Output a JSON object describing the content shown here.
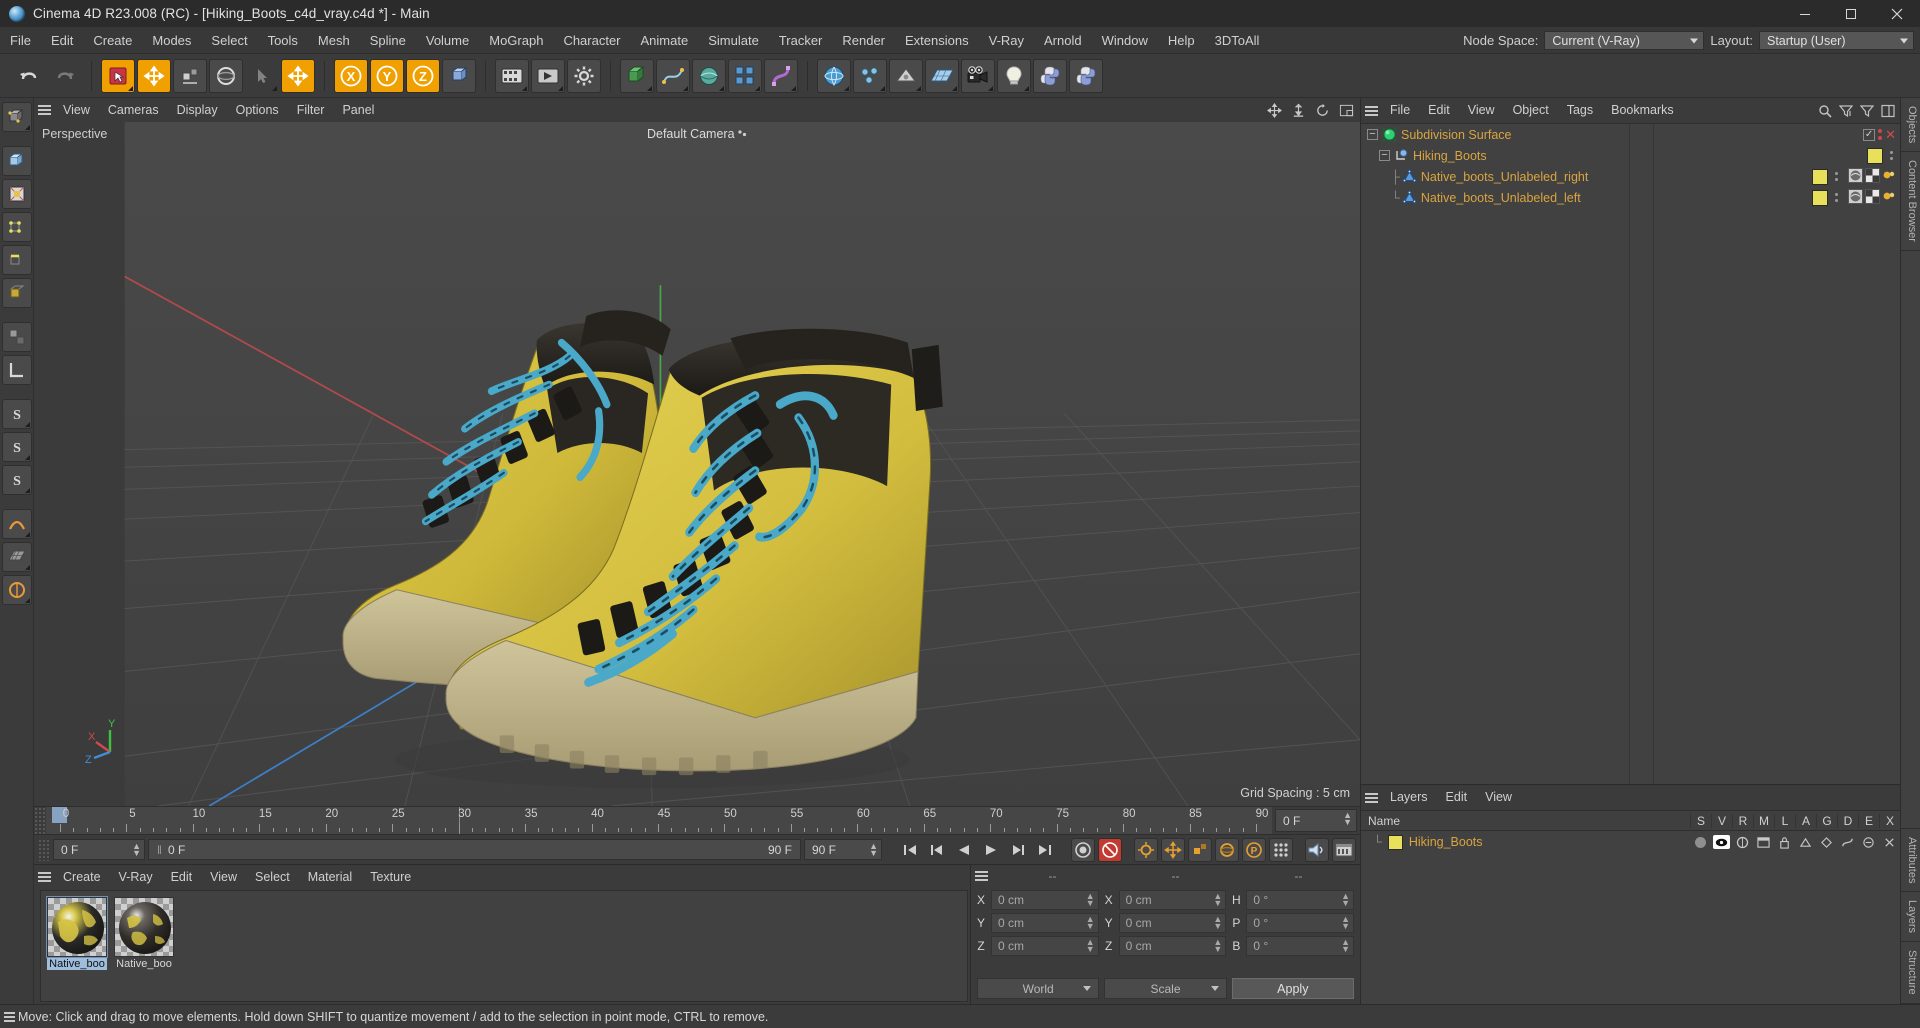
{
  "window": {
    "title": "Cinema 4D R23.008 (RC) - [Hiking_Boots_c4d_vray.c4d *] - Main",
    "logo": "cinema4d-logo-icon",
    "minimize": "minimize-icon",
    "maximize": "maximize-icon",
    "close": "close-icon"
  },
  "menubar": {
    "items": [
      "File",
      "Edit",
      "Create",
      "Modes",
      "Select",
      "Tools",
      "Mesh",
      "Spline",
      "Volume",
      "MoGraph",
      "Character",
      "Animate",
      "Simulate",
      "Tracker",
      "Render",
      "Extensions",
      "V-Ray",
      "Arnold",
      "Window",
      "Help",
      "3DToAll"
    ],
    "node_space_label": "Node Space:",
    "node_space_value": "Current (V-Ray)",
    "layout_label": "Layout:",
    "layout_value": "Startup (User)"
  },
  "toolbar": {
    "buttons": [
      {
        "name": "undo-button",
        "icon": "undo-icon"
      },
      {
        "name": "redo-button",
        "icon": "redo-icon"
      },
      {
        "name": "live-selection-button",
        "icon": "live-selection-icon"
      },
      {
        "name": "move-tool-button",
        "icon": "move-icon"
      },
      {
        "name": "scale-tool-button",
        "icon": "scale-icon"
      },
      {
        "name": "rotate-tool-button",
        "icon": "rotate-icon"
      },
      {
        "name": "last-used-tool-button",
        "icon": "cursor-icon"
      },
      {
        "name": "world-object-axis-button",
        "icon": "axis-icon"
      },
      {
        "name": "lock-x-axis-button",
        "icon": "x-axis-icon"
      },
      {
        "name": "lock-y-axis-button",
        "icon": "y-axis-icon"
      },
      {
        "name": "lock-z-axis-button",
        "icon": "z-axis-icon"
      },
      {
        "name": "world-coordinate-system-button",
        "icon": "world-axis-icon"
      },
      {
        "name": "render-view-button",
        "icon": "render-view-icon"
      },
      {
        "name": "render-region-button",
        "icon": "render-region-icon"
      },
      {
        "name": "render-settings-button",
        "icon": "render-settings-icon"
      },
      {
        "name": "add-cube-button",
        "icon": "cube-icon"
      },
      {
        "name": "add-spline-button",
        "icon": "spline-icon"
      },
      {
        "name": "add-nurbs-button",
        "icon": "nurbs-icon"
      },
      {
        "name": "add-array-button",
        "icon": "array-icon"
      },
      {
        "name": "add-bend-deformer-button",
        "icon": "deformer-icon"
      },
      {
        "name": "add-scene-button",
        "icon": "environment-icon"
      },
      {
        "name": "add-mograph-button",
        "icon": "mograph-icon"
      },
      {
        "name": "add-field-button",
        "icon": "field-icon"
      },
      {
        "name": "add-floor-button",
        "icon": "floor-icon"
      },
      {
        "name": "add-camera-button",
        "icon": "camera-icon"
      },
      {
        "name": "add-light-button",
        "icon": "light-icon"
      },
      {
        "name": "python-script-button",
        "icon": "python-icon"
      },
      {
        "name": "python-generator-button",
        "icon": "python-icon"
      }
    ]
  },
  "leftbar": {
    "buttons": [
      {
        "name": "editable-object-button",
        "icon": "make-editable-icon"
      },
      {
        "name": "model-mode-button",
        "icon": "model-mode-icon"
      },
      {
        "name": "texture-mode-button",
        "icon": "texture-mode-icon"
      },
      {
        "name": "points-mode-button",
        "icon": "points-mode-icon"
      },
      {
        "name": "edges-mode-button",
        "icon": "edges-mode-icon"
      },
      {
        "name": "polygons-mode-button",
        "icon": "polygons-mode-icon"
      },
      {
        "name": "workplane-button",
        "icon": "workplane-icon"
      },
      {
        "name": "measure-button",
        "icon": "measure-icon"
      },
      {
        "name": "enable-axis-button",
        "icon": "axis-modify-icon"
      },
      {
        "name": "enable-snapping-button",
        "icon": "snap-s-icon"
      },
      {
        "name": "quantize-button",
        "icon": "quantize-s-icon"
      },
      {
        "name": "workplane-lock-button",
        "icon": "lock-s-icon"
      },
      {
        "name": "soft-selection-button",
        "icon": "soft-selection-icon"
      },
      {
        "name": "viewport-solo-button",
        "icon": "solo-icon"
      },
      {
        "name": "layer-button",
        "icon": "layer-icon"
      }
    ]
  },
  "viewport": {
    "menu": [
      "View",
      "Cameras",
      "Display",
      "Options",
      "Filter",
      "Panel"
    ],
    "view_label": "Perspective",
    "camera_label": "Default Camera",
    "grid_spacing": "Grid Spacing : 5 cm",
    "right_icons": [
      "move-camera-icon",
      "scale-camera-icon",
      "rotate-camera-icon",
      "maximize-viewport-icon"
    ],
    "axis_gizmo": {
      "x": "X",
      "y": "Y",
      "z": "Z"
    }
  },
  "timeline": {
    "ticks": [
      0,
      5,
      10,
      15,
      20,
      25,
      30,
      35,
      40,
      45,
      50,
      55,
      60,
      65,
      70,
      75,
      80,
      85,
      90
    ],
    "current_frame_field": "0 F",
    "playhead_frame": 0,
    "cursor_frame": 30
  },
  "powerbar": {
    "start_frame": "0 F",
    "preview_from": "0 F",
    "preview_to": "90 F",
    "end_frame": "90 F",
    "fps_field": "90 F",
    "buttons": [
      {
        "name": "go-to-start-button",
        "icon": "skip-start-icon"
      },
      {
        "name": "step-back-button",
        "icon": "step-back-icon"
      },
      {
        "name": "play-backwards-button",
        "icon": "play-back-icon"
      },
      {
        "name": "play-button",
        "icon": "play-icon"
      },
      {
        "name": "step-forward-button",
        "icon": "step-forward-icon"
      },
      {
        "name": "go-to-end-button",
        "icon": "skip-end-icon"
      },
      {
        "name": "record-active-objects-button",
        "icon": "record-icon"
      },
      {
        "name": "autokeying-button",
        "icon": "autokey-icon"
      },
      {
        "name": "keyframe-selection-button",
        "icon": "keyframe-select-icon"
      },
      {
        "name": "position-key-button",
        "icon": "position-key-icon"
      },
      {
        "name": "scale-key-button",
        "icon": "scale-key-icon"
      },
      {
        "name": "rotation-key-button",
        "icon": "rotation-key-icon"
      },
      {
        "name": "parameter-key-button",
        "icon": "param-key-icon"
      },
      {
        "name": "point-level-animation-button",
        "icon": "pla-icon"
      },
      {
        "name": "sound-button",
        "icon": "sound-icon"
      },
      {
        "name": "timeline-button",
        "icon": "timeline-icon"
      }
    ]
  },
  "material_manager": {
    "menu": [
      "Create",
      "V-Ray",
      "Edit",
      "View",
      "Select",
      "Material",
      "Texture"
    ],
    "materials": [
      {
        "name": "Native_boo",
        "selected": true
      },
      {
        "name": "Native_boo",
        "selected": false
      }
    ]
  },
  "coordinates": {
    "headers": [
      "--",
      "--",
      "--"
    ],
    "rows": [
      {
        "pos_label": "X",
        "pos_value": "0 cm",
        "size_label": "X",
        "size_value": "0 cm",
        "rot_label": "H",
        "rot_value": "0 °"
      },
      {
        "pos_label": "Y",
        "pos_value": "0 cm",
        "size_label": "Y",
        "size_value": "0 cm",
        "rot_label": "P",
        "rot_value": "0 °"
      },
      {
        "pos_label": "Z",
        "pos_value": "0 cm",
        "size_label": "Z",
        "size_value": "0 cm",
        "rot_label": "B",
        "rot_value": "0 °"
      }
    ],
    "system": "World",
    "mode": "Scale",
    "apply": "Apply"
  },
  "object_manager": {
    "menu": [
      "File",
      "Edit",
      "View",
      "Object",
      "Tags",
      "Bookmarks"
    ],
    "right_icons": [
      "search-icon",
      "filter-up-icon",
      "filter-icon",
      "new-layout-icon"
    ],
    "tree": [
      {
        "label": "Subdivision Surface",
        "icon": "subdivision-surface-icon",
        "depth": 0,
        "expandable": true,
        "tags": [],
        "enabled": true
      },
      {
        "label": "Hiking_Boots",
        "icon": "null-object-icon",
        "depth": 1,
        "expandable": true,
        "tags": [],
        "enabled": false
      },
      {
        "label": "Native_boots_Unlabeled_right",
        "icon": "polygon-object-icon",
        "depth": 2,
        "expandable": false,
        "tags": [
          "texture-tag",
          "uv-tag",
          "phong-tag"
        ],
        "enabled": false
      },
      {
        "label": "Native_boots_Unlabeled_left",
        "icon": "polygon-object-icon",
        "depth": 2,
        "expandable": false,
        "tags": [
          "texture-tag",
          "uv-tag",
          "phong-tag"
        ],
        "enabled": false
      }
    ]
  },
  "layers_manager": {
    "menu": [
      "Layers",
      "Edit",
      "View"
    ],
    "columns": [
      "Name",
      "S",
      "V",
      "R",
      "M",
      "L",
      "A",
      "G",
      "D",
      "E",
      "X"
    ],
    "rows": [
      {
        "name": "Hiking_Boots",
        "color": "#e8e05a"
      }
    ],
    "row_icons": [
      "solo-dot-icon",
      "eye-icon",
      "render-icon",
      "manager-icon",
      "lock-icon",
      "animation-icon",
      "generator-icon",
      "deformer-icon",
      "expression-icon",
      "xref-icon"
    ]
  },
  "right_rail": {
    "tabs": [
      "Objects",
      "Content Browser",
      "Attributes",
      "Layers",
      "Structure"
    ]
  },
  "statusbar": {
    "message": "Move: Click and drag to move elements. Hold down SHIFT to quantize movement / add to the selection in point mode, CTRL to remove."
  },
  "colors": {
    "accent_orange": "#d9a441",
    "layer_yellow": "#e8e05a",
    "boot_yellow": "#d6c23c",
    "lace_blue": "#4aa8c8",
    "record_red": "#c13b32",
    "highlight_blue": "#9fbede"
  }
}
